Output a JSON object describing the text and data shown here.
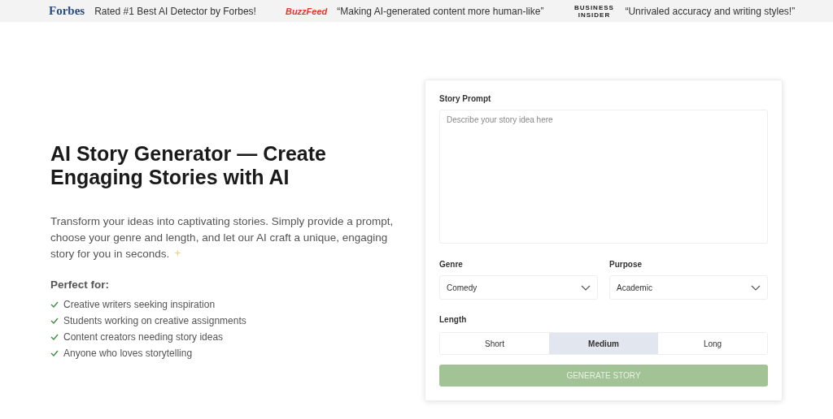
{
  "press_bar": [
    {
      "logo": "Forbes",
      "kind": "serif",
      "quote": "Rated #1 Best AI Detector by Forbes!"
    },
    {
      "logo": "BuzzFeed",
      "kind": "red",
      "quote": "“Making AI-generated content more human-like”"
    },
    {
      "logo": "BUSINESS INSIDER",
      "kind": "stacked",
      "quote": "“Unrivaled accuracy and writing styles!”"
    }
  ],
  "hero": {
    "title": "AI Story Generator — Create Engaging Stories with AI",
    "description": "Transform your ideas into captivating stories. Simply provide a prompt, choose your genre and length, and let our AI craft a unique, engaging story for you in seconds.",
    "perfect_for_heading": "Perfect for:",
    "perfect_for": [
      "Creative writers seeking inspiration",
      "Students working on creative assignments",
      "Content creators needing story ideas",
      "Anyone who loves storytelling"
    ]
  },
  "form": {
    "prompt_label": "Story Prompt",
    "prompt_placeholder": "Describe your story idea here",
    "genre": {
      "label": "Genre",
      "value": "Comedy"
    },
    "purpose": {
      "label": "Purpose",
      "value": "Academic"
    },
    "length_label": "Length",
    "lengths": [
      {
        "label": "Short",
        "selected": false
      },
      {
        "label": "Medium",
        "selected": true
      },
      {
        "label": "Long",
        "selected": false
      }
    ],
    "generate_button": {
      "label": "GENERATE STORY",
      "disabled": true
    }
  }
}
